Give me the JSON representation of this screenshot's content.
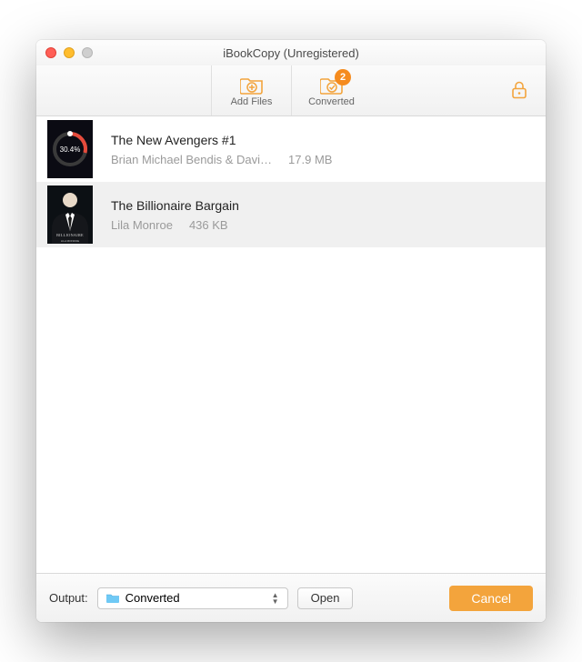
{
  "window": {
    "title": "iBookCopy (Unregistered)"
  },
  "toolbar": {
    "add_files_label": "Add Files",
    "converted_label": "Converted",
    "converted_badge": "2"
  },
  "books": [
    {
      "title": "The New Avengers #1",
      "author": "Brian Michael Bendis & Davi…",
      "size": "17.9 MB",
      "progress_text": "30.4%",
      "cover_style": "progress"
    },
    {
      "title": "The Billionaire Bargain",
      "author": "Lila Monroe",
      "size": "436 KB",
      "cover_style": "suit"
    }
  ],
  "bottombar": {
    "output_label": "Output:",
    "selected_folder": "Converted",
    "open_label": "Open",
    "cancel_label": "Cancel"
  },
  "colors": {
    "accent": "#f3a43c"
  }
}
